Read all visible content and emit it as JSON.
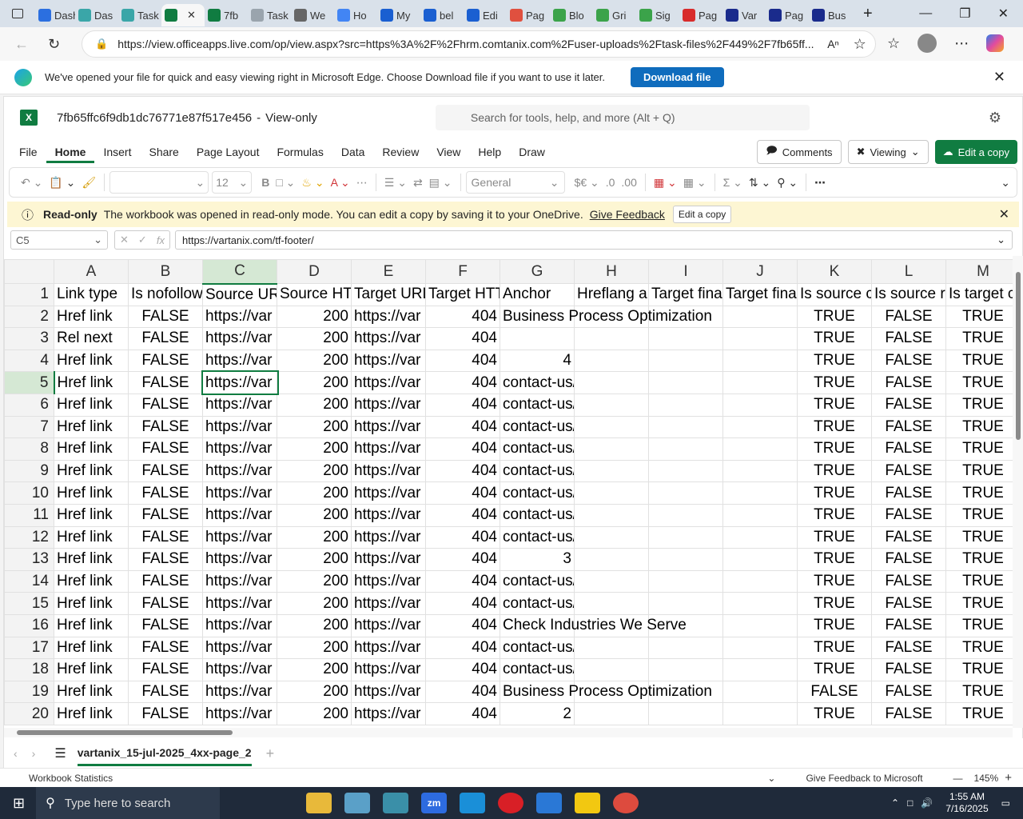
{
  "browser": {
    "tabs": [
      {
        "label": "Dash",
        "color": "#2b6fe0"
      },
      {
        "label": "Das",
        "color": "#3aa6a8"
      },
      {
        "label": "Task",
        "color": "#3aa6a8"
      },
      {
        "label": "",
        "color": "#107c41",
        "active": true
      },
      {
        "label": "7fb",
        "color": "#107c41"
      },
      {
        "label": "Task",
        "color": "#9aa4ad"
      },
      {
        "label": "We",
        "color": "#666666"
      },
      {
        "label": "Ho",
        "color": "#4285f4"
      },
      {
        "label": "My",
        "color": "#1a5fd1"
      },
      {
        "label": "bel",
        "color": "#1a5fd1"
      },
      {
        "label": "Edi",
        "color": "#1a5fd1"
      },
      {
        "label": "Pag",
        "color": "#e0503f"
      },
      {
        "label": "Blo",
        "color": "#3ba34a"
      },
      {
        "label": "Gri",
        "color": "#3ba34a"
      },
      {
        "label": "Sig",
        "color": "#3ba34a"
      },
      {
        "label": "Pag",
        "color": "#d82b2b"
      },
      {
        "label": "Var",
        "color": "#1a2b8c"
      },
      {
        "label": "Pag",
        "color": "#1a2b8c"
      },
      {
        "label": "Bus",
        "color": "#1a2b8c"
      }
    ],
    "url": "https://view.officeapps.live.com/op/view.aspx?src=https%3A%2F%2Fhrm.comtanix.com%2Fuser-uploads%2Ftask-files%2F449%2F7fb65ff...",
    "infobar_text": "We've opened your file for quick and easy viewing right in Microsoft Edge. Choose Download file if you want to use it later.",
    "download_label": "Download file"
  },
  "excel": {
    "filename": "7fb65ffc6f9db1dc76771e87f517e456",
    "mode": "View-only",
    "search_placeholder": "Search for tools, help, and more (Alt + Q)",
    "menus": [
      "File",
      "Home",
      "Insert",
      "Share",
      "Page Layout",
      "Formulas",
      "Data",
      "Review",
      "View",
      "Help",
      "Draw"
    ],
    "comments_label": "Comments",
    "viewing_label": "Viewing",
    "edit_copy_label": "Edit a copy",
    "font_size": "12",
    "number_format": "General",
    "readonly_title": "Read-only",
    "readonly_msg": "The workbook was opened in read-only mode. You can edit a copy by saving it to your OneDrive.",
    "give_feedback": "Give Feedback",
    "edit_copy_small": "Edit a copy",
    "namebox": "C5",
    "formula": "https://vartanix.com/tf-footer/",
    "columns": [
      "A",
      "B",
      "C",
      "D",
      "E",
      "F",
      "G",
      "H",
      "I",
      "J",
      "K",
      "L",
      "M"
    ],
    "rows": [
      [
        "Link type",
        "Is nofollow",
        "Source UR",
        "Source HT",
        "Target URL",
        "Target HTT",
        "Anchor",
        "Hreflang a",
        "Target fina",
        "Target fina",
        "Is source c",
        "Is source r",
        "Is target c"
      ],
      [
        "Href link",
        "FALSE",
        "https://var",
        "200",
        "https://var",
        "404",
        "Business Process Optimization",
        "",
        "",
        "",
        "TRUE",
        "FALSE",
        "TRUE"
      ],
      [
        "Rel next",
        "FALSE",
        "https://var",
        "200",
        "https://var",
        "404",
        "",
        "",
        "",
        "",
        "TRUE",
        "FALSE",
        "TRUE"
      ],
      [
        "Href link",
        "FALSE",
        "https://var",
        "200",
        "https://var",
        "404",
        "4",
        "",
        "",
        "",
        "TRUE",
        "FALSE",
        "TRUE"
      ],
      [
        "Href link",
        "FALSE",
        "https://var",
        "200",
        "https://var",
        "404",
        "contact-us/",
        "",
        "",
        "",
        "TRUE",
        "FALSE",
        "TRUE"
      ],
      [
        "Href link",
        "FALSE",
        "https://var",
        "200",
        "https://var",
        "404",
        "contact-us/",
        "",
        "",
        "",
        "TRUE",
        "FALSE",
        "TRUE"
      ],
      [
        "Href link",
        "FALSE",
        "https://var",
        "200",
        "https://var",
        "404",
        "contact-us/",
        "",
        "",
        "",
        "TRUE",
        "FALSE",
        "TRUE"
      ],
      [
        "Href link",
        "FALSE",
        "https://var",
        "200",
        "https://var",
        "404",
        "contact-us/",
        "",
        "",
        "",
        "TRUE",
        "FALSE",
        "TRUE"
      ],
      [
        "Href link",
        "FALSE",
        "https://var",
        "200",
        "https://var",
        "404",
        "contact-us/",
        "",
        "",
        "",
        "TRUE",
        "FALSE",
        "TRUE"
      ],
      [
        "Href link",
        "FALSE",
        "https://var",
        "200",
        "https://var",
        "404",
        "contact-us/",
        "",
        "",
        "",
        "TRUE",
        "FALSE",
        "TRUE"
      ],
      [
        "Href link",
        "FALSE",
        "https://var",
        "200",
        "https://var",
        "404",
        "contact-us/",
        "",
        "",
        "",
        "TRUE",
        "FALSE",
        "TRUE"
      ],
      [
        "Href link",
        "FALSE",
        "https://var",
        "200",
        "https://var",
        "404",
        "contact-us/",
        "",
        "",
        "",
        "TRUE",
        "FALSE",
        "TRUE"
      ],
      [
        "Href link",
        "FALSE",
        "https://var",
        "200",
        "https://var",
        "404",
        "3",
        "",
        "",
        "",
        "TRUE",
        "FALSE",
        "TRUE"
      ],
      [
        "Href link",
        "FALSE",
        "https://var",
        "200",
        "https://var",
        "404",
        "contact-us/",
        "",
        "",
        "",
        "TRUE",
        "FALSE",
        "TRUE"
      ],
      [
        "Href link",
        "FALSE",
        "https://var",
        "200",
        "https://var",
        "404",
        "contact-us/",
        "",
        "",
        "",
        "TRUE",
        "FALSE",
        "TRUE"
      ],
      [
        "Href link",
        "FALSE",
        "https://var",
        "200",
        "https://var",
        "404",
        "Check Industries We Serve",
        "",
        "",
        "",
        "TRUE",
        "FALSE",
        "TRUE"
      ],
      [
        "Href link",
        "FALSE",
        "https://var",
        "200",
        "https://var",
        "404",
        "contact-us/",
        "",
        "",
        "",
        "TRUE",
        "FALSE",
        "TRUE"
      ],
      [
        "Href link",
        "FALSE",
        "https://var",
        "200",
        "https://var",
        "404",
        "contact-us/",
        "",
        "",
        "",
        "TRUE",
        "FALSE",
        "TRUE"
      ],
      [
        "Href link",
        "FALSE",
        "https://var",
        "200",
        "https://var",
        "404",
        "Business Process Optimization",
        "",
        "",
        "",
        "FALSE",
        "FALSE",
        "TRUE"
      ],
      [
        "Href link",
        "FALSE",
        "https://var",
        "200",
        "https://var",
        "404",
        "2",
        "",
        "",
        "",
        "TRUE",
        "FALSE",
        "TRUE"
      ]
    ],
    "sheet_tab": "vartanix_15-jul-2025_4xx-page_2",
    "status_left": "Workbook Statistics",
    "status_feedback": "Give Feedback to Microsoft",
    "zoom": "145%"
  },
  "taskbar": {
    "search_placeholder": "Type here to search",
    "time": "1:55 AM",
    "date": "7/16/2025"
  }
}
